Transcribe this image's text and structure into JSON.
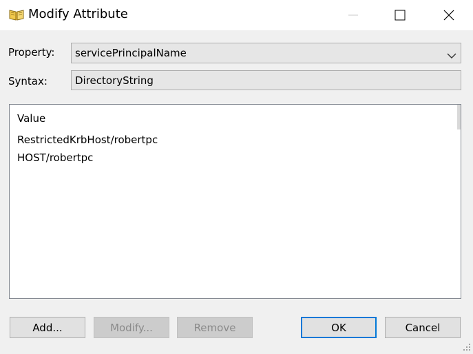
{
  "window": {
    "title": "Modify Attribute"
  },
  "form": {
    "property_label": "Property:",
    "property_value": "servicePrincipalName",
    "syntax_label": "Syntax:",
    "syntax_value": "DirectoryString"
  },
  "values_list": {
    "header": "Value",
    "items": [
      "RestrictedKrbHost/robertpc",
      "HOST/robertpc"
    ]
  },
  "buttons": {
    "add": "Add...",
    "modify": "Modify...",
    "remove": "Remove",
    "ok": "OK",
    "cancel": "Cancel"
  },
  "colors": {
    "dialog_bg": "#f0f0f0",
    "default_button_border": "#0078d7"
  }
}
